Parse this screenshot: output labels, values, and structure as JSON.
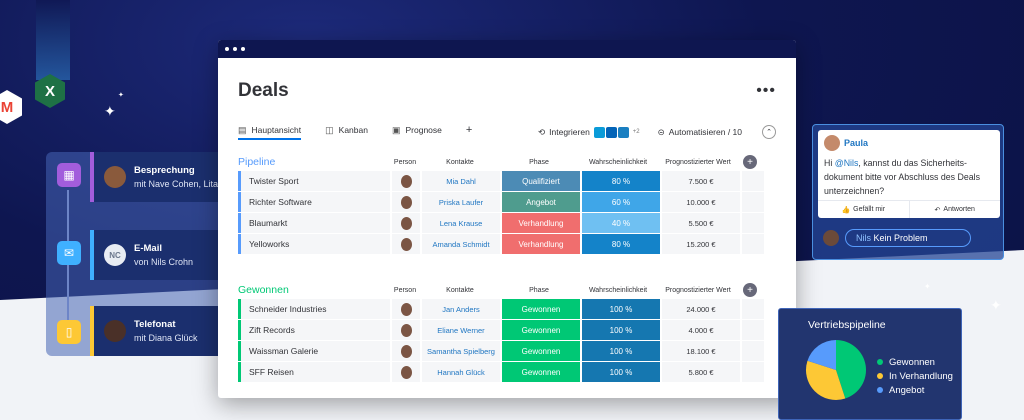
{
  "colors": {
    "pipeline": "#579bfc",
    "won": "#00c875",
    "qualified": "#4c8bb5",
    "offer": "#4f9c8e",
    "negotiation": "#f06e6e",
    "prob_dark": "#1483c9",
    "prob_mid": "#3fa6e8",
    "prob_light": "#6fc0f2",
    "won_prob": "#1577b0"
  },
  "timeline": [
    {
      "icon": "calendar-icon",
      "title": "Besprechung",
      "subtitle": "mit Nave Cohen, Lital",
      "accent": "#a25ddc"
    },
    {
      "icon": "mail-icon",
      "title": "E-Mail",
      "subtitle": "von Nils Crohn",
      "initials": "NC",
      "accent": "#3fb0ff"
    },
    {
      "icon": "phone-icon",
      "title": "Telefonat",
      "subtitle": "mit Diana Glück",
      "accent": "#fdc835"
    }
  ],
  "board": {
    "title": "Deals",
    "tabs": [
      {
        "label": "Hauptansicht",
        "icon": "table-icon"
      },
      {
        "label": "Kanban",
        "icon": "kanban-icon"
      },
      {
        "label": "Prognose",
        "icon": "chart-icon"
      }
    ],
    "add_tab": "+",
    "integrate_label": "Integrieren",
    "integrate_more": "+2",
    "automate_label": "Automatisieren / 10",
    "columns": {
      "person": "Person",
      "contacts": "Kontakte",
      "phase": "Phase",
      "probability": "Wahrscheinlichkeit",
      "forecast": "Prognostizierter Wert"
    },
    "pipeline": {
      "name": "Pipeline",
      "rows": [
        {
          "name": "Twister Sport",
          "contact": "Mia Dahl",
          "phase": "Qualifiziert",
          "phase_color": "#4c8bb5",
          "prob": "80 %",
          "prob_color": "#1483c9",
          "value": "7.500 €"
        },
        {
          "name": "Richter Software",
          "contact": "Priska Laufer",
          "phase": "Angebot",
          "phase_color": "#4f9c8e",
          "prob": "60 %",
          "prob_color": "#3fa6e8",
          "value": "10.000 €"
        },
        {
          "name": "Blaumarkt",
          "contact": "Lena Krause",
          "phase": "Verhandlung",
          "phase_color": "#f06e6e",
          "prob": "40 %",
          "prob_color": "#6fc0f2",
          "value": "5.500 €"
        },
        {
          "name": "Yelloworks",
          "contact": "Amanda Schmidt",
          "phase": "Verhandlung",
          "phase_color": "#f06e6e",
          "prob": "80 %",
          "prob_color": "#1483c9",
          "value": "15.200 €"
        }
      ]
    },
    "won": {
      "name": "Gewonnen",
      "rows": [
        {
          "name": "Schneider Industries",
          "contact": "Jan Anders",
          "phase": "Gewonnen",
          "prob": "100 %",
          "value": "24.000 €"
        },
        {
          "name": "Zift Records",
          "contact": "Eliane Werner",
          "phase": "Gewonnen",
          "prob": "100 %",
          "value": "4.000 €"
        },
        {
          "name": "Waissman Galerie",
          "contact": "Samantha Spielberg",
          "phase": "Gewonnen",
          "prob": "100 %",
          "value": "18.100 €"
        },
        {
          "name": "SFF Reisen",
          "contact": "Hannah Glück",
          "phase": "Gewonnen",
          "prob": "100 %",
          "value": "5.800 €"
        }
      ]
    }
  },
  "chat": {
    "author": "Paula",
    "mention": "@Nils",
    "message_a": "Hi ",
    "message_b": ", kannst du das Sicherheits-dokument bitte vor Abschluss des Deals unterzeichnen?",
    "like_label": "Gefällt mir",
    "reply_label": "Antworten",
    "reply_mention": "Nils",
    "reply_text": " Kein Problem"
  },
  "pie": {
    "title": "Vertriebspipeline",
    "legend": [
      {
        "label": "Gewonnen",
        "color": "#00c875"
      },
      {
        "label": "In Verhandlung",
        "color": "#fdc835"
      },
      {
        "label": "Angebot",
        "color": "#579bfc"
      }
    ]
  },
  "chart_data": {
    "type": "pie",
    "title": "Vertriebspipeline",
    "categories": [
      "Gewonnen",
      "In Verhandlung",
      "Angebot"
    ],
    "values": [
      45,
      35,
      20
    ]
  }
}
